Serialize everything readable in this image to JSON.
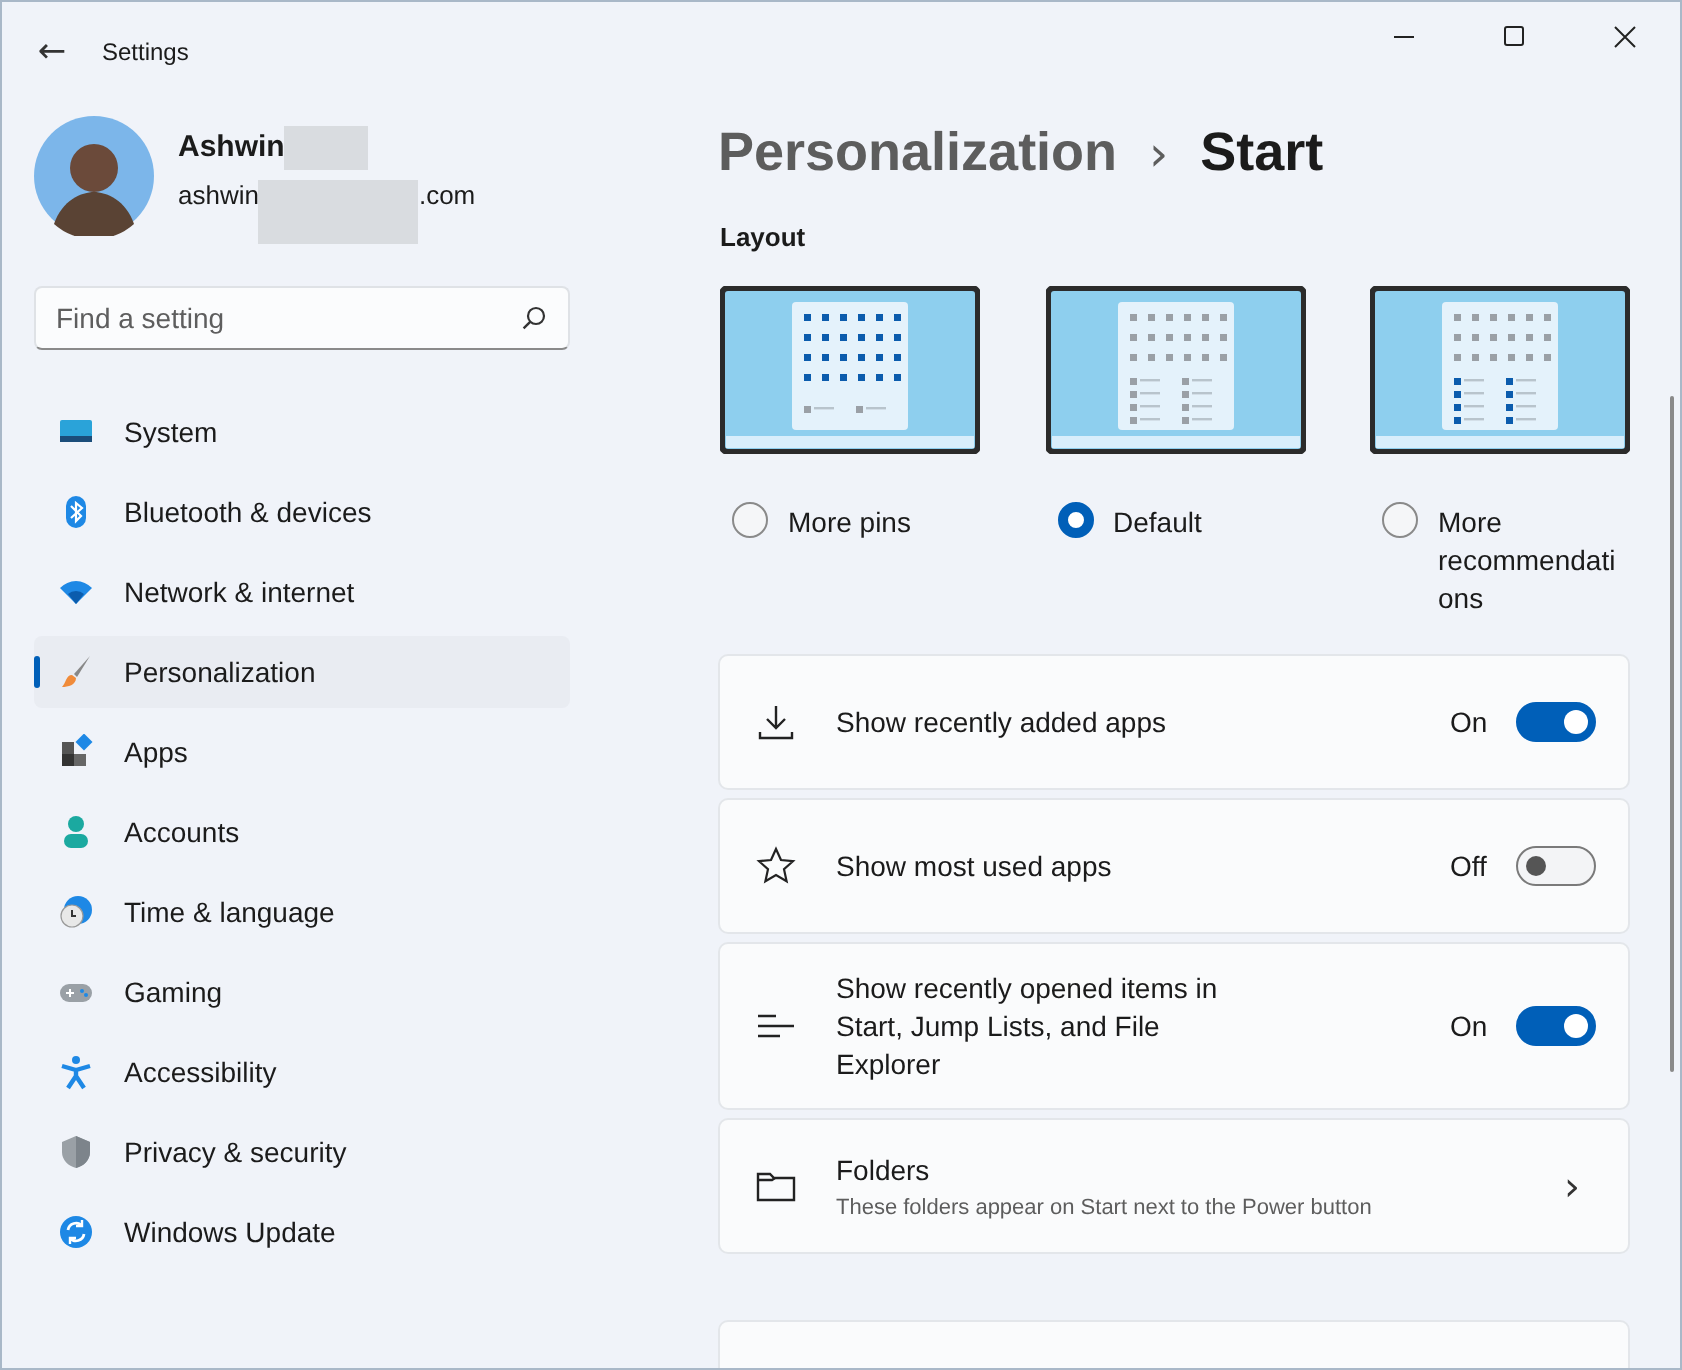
{
  "window": {
    "title": "Settings",
    "back": "←"
  },
  "account": {
    "name": "Ashwin",
    "email_start": "ashwin",
    "email_end": ".com"
  },
  "search": {
    "placeholder": "Find a setting"
  },
  "sidebar": {
    "items": [
      {
        "label": "System",
        "selected": false
      },
      {
        "label": "Bluetooth & devices",
        "selected": false
      },
      {
        "label": "Network & internet",
        "selected": false
      },
      {
        "label": "Personalization",
        "selected": true
      },
      {
        "label": "Apps",
        "selected": false
      },
      {
        "label": "Accounts",
        "selected": false
      },
      {
        "label": "Time & language",
        "selected": false
      },
      {
        "label": "Gaming",
        "selected": false
      },
      {
        "label": "Accessibility",
        "selected": false
      },
      {
        "label": "Privacy & security",
        "selected": false
      },
      {
        "label": "Windows Update",
        "selected": false
      }
    ]
  },
  "breadcrumb": {
    "parent": "Personalization",
    "separator": "›",
    "current": "Start"
  },
  "layout": {
    "heading": "Layout",
    "options": [
      {
        "kind": "pins",
        "label": "More pins",
        "selected": false
      },
      {
        "kind": "default",
        "label": "Default",
        "selected": true
      },
      {
        "kind": "recommendations",
        "label": "More recommendations",
        "selected": false
      }
    ]
  },
  "settings": [
    {
      "kind": "toggle",
      "title": "Show recently added apps",
      "on": true,
      "reading": "On"
    },
    {
      "kind": "toggle",
      "title": "Show most used apps",
      "on": false,
      "reading": "Off"
    },
    {
      "kind": "toggle",
      "title": "Show recently opened items in Start, Jump Lists, and File Explorer",
      "on": true,
      "reading": "On"
    },
    {
      "kind": "link",
      "title": "Folders",
      "description": "These folders appear on Start next to the Power button",
      "chevron": "›"
    }
  ]
}
